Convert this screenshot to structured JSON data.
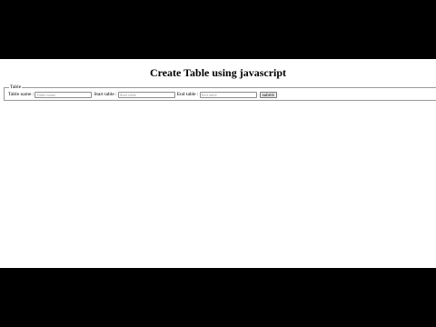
{
  "page": {
    "title": "Create Table using javascript"
  },
  "form": {
    "legend": "Table",
    "fields": [
      {
        "label": "Table name :",
        "placeholder": "Table name",
        "value": ""
      },
      {
        "label": "Start table :",
        "placeholder": "Start table",
        "value": ""
      },
      {
        "label": "End table :",
        "placeholder": "End table",
        "value": ""
      }
    ],
    "submit_label": "submit"
  },
  "colors": {
    "letterbox": "#000000",
    "page_background": "#ffffff",
    "fieldset_border": "#9a9a9a"
  }
}
